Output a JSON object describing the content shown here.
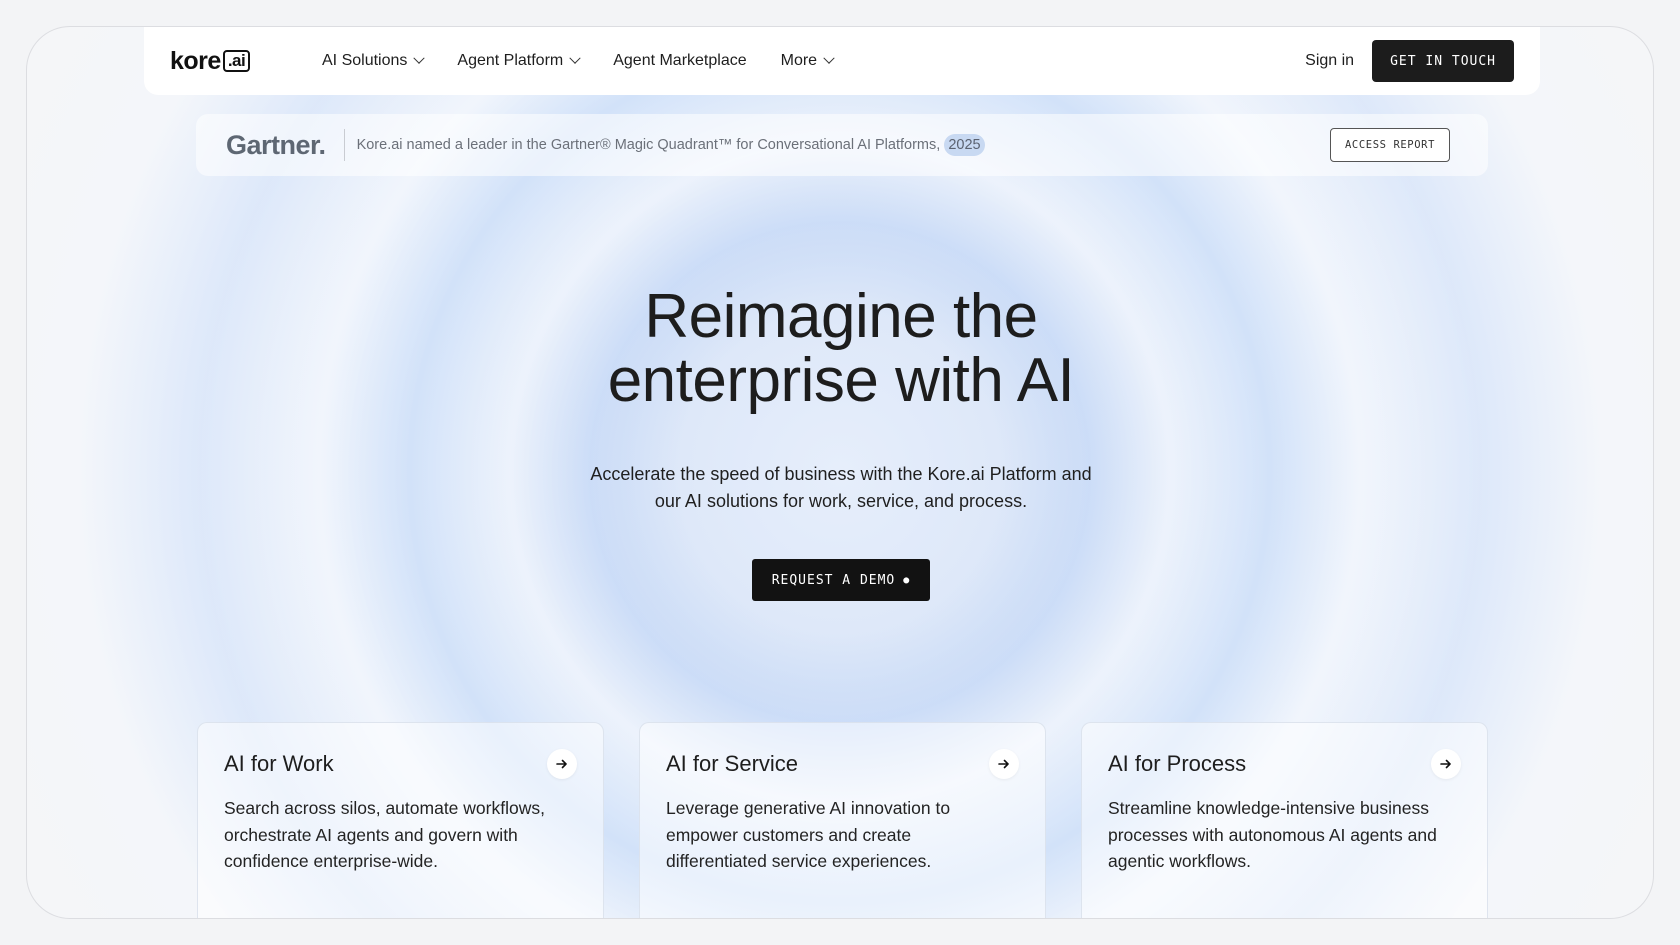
{
  "logo": {
    "text": "kore",
    "ai": ".ai"
  },
  "nav": {
    "items": [
      {
        "label": "AI Solutions",
        "dropdown": true
      },
      {
        "label": "Agent Platform",
        "dropdown": true
      },
      {
        "label": "Agent Marketplace",
        "dropdown": false
      },
      {
        "label": "More",
        "dropdown": true
      }
    ],
    "signin": "Sign in",
    "cta": "GET IN TOUCH"
  },
  "banner": {
    "brand": "Gartner",
    "text": "Kore.ai named a leader in the Gartner® Magic Quadrant™ for Conversational AI Platforms,",
    "year": "2025",
    "button": "ACCESS REPORT"
  },
  "hero": {
    "title_line1": "Reimagine the",
    "title_line2": "enterprise with AI",
    "subtitle": "Accelerate the speed of business with the Kore.ai Platform and our AI solutions for work, service, and process.",
    "cta": "REQUEST A DEMO"
  },
  "cards": [
    {
      "title": "AI for Work",
      "desc": "Search across silos, automate workflows, orchestrate AI agents and govern with confidence enterprise-wide."
    },
    {
      "title": "AI for Service",
      "desc": "Leverage generative AI innovation to empower customers and create differentiated service experiences."
    },
    {
      "title": "AI for Process",
      "desc": "Streamline knowledge-intensive business processes with autonomous AI agents and agentic workflows."
    }
  ],
  "colors": {
    "accent_dark": "#1c1c1c",
    "hero_glow": "#c8d9f2"
  }
}
